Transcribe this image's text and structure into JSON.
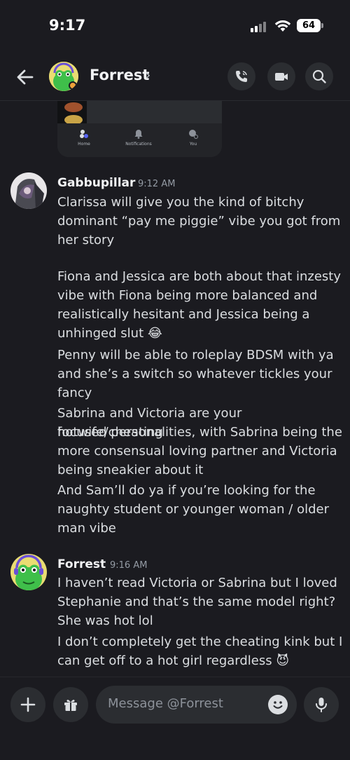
{
  "status": {
    "time": "9:17",
    "battery": "64"
  },
  "header": {
    "title": "Forrest",
    "chevron": "›"
  },
  "preview": {
    "nav": [
      {
        "label": "Home",
        "icon": "home-icon"
      },
      {
        "label": "Notifications",
        "icon": "bell-icon"
      },
      {
        "label": "You",
        "icon": "profile-icon"
      }
    ]
  },
  "messages": [
    {
      "author": "Gabbupillar",
      "time": "9:12 AM",
      "lines": [
        "Clarissa will give you the kind of bitchy",
        "dominant “pay me piggie” vibe you got from",
        "her story",
        "",
        "Fiona and Jessica are both about that inzesty",
        "vibe with Fiona being more balanced and",
        "realistically hesitant and Jessica being a",
        "unhinged slut 😂",
        "Penny will be able to roleplay BDSM with ya",
        "and she’s a switch so whatever tickles your",
        "fancy",
        "Sabrina and Victoria are your hotwife/cheating",
        "focused personalities, with Sabrina being the",
        "more consensual loving partner and Victoria",
        "being sneakier about it",
        "And Sam’ll do ya if you’re looking for the",
        "naughty student or younger woman / older",
        "man vibe"
      ]
    },
    {
      "author": "Forrest",
      "time": "9:16 AM",
      "lines": [
        "I haven’t read Victoria or Sabrina but I loved",
        "Stephanie and that’s the same model right?",
        "She was hot lol",
        "I don’t completely get the cheating kink but I",
        "can get off to a hot girl regardless 😈"
      ]
    }
  ],
  "composer": {
    "placeholder": "Message @Forrest"
  },
  "colors": {
    "background": "#1b1b20",
    "surface": "#2b2d31",
    "text": "#dbdee1",
    "muted": "#949ba4"
  }
}
